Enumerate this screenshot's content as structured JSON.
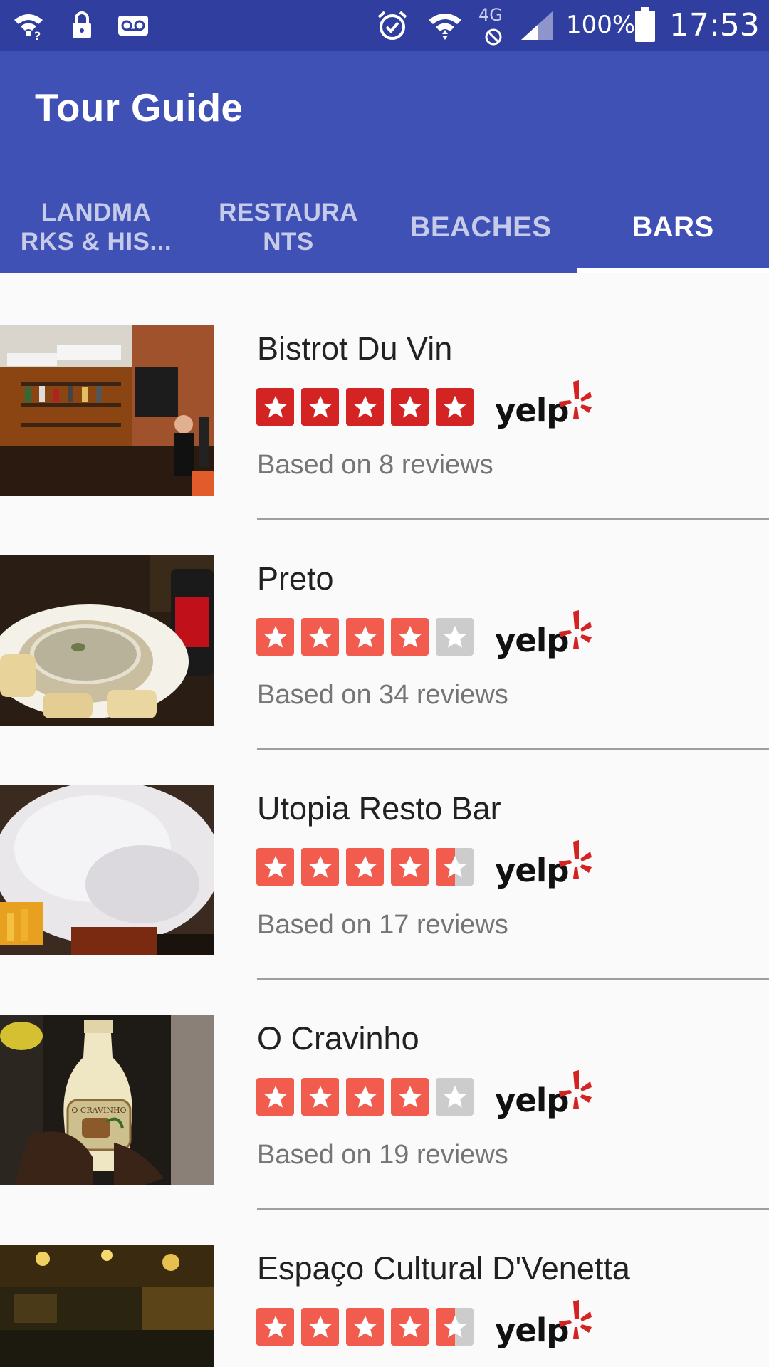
{
  "status_bar": {
    "battery": "100%",
    "time": "17:53",
    "network": "4G",
    "icons": [
      "wifi-question-icon",
      "lock-icon",
      "voicemail-icon",
      "alarm-icon",
      "wifi-icon",
      "no-data-icon",
      "signal-icon",
      "battery-icon"
    ]
  },
  "app_bar": {
    "title": "Tour Guide",
    "background": "#3f51b5",
    "status_background": "#303f9f"
  },
  "tabs": [
    {
      "label": "LANDMA\nRKS & HIS...",
      "active": false
    },
    {
      "label": "RESTAURA\nNTS",
      "active": false
    },
    {
      "label": "BEACHES",
      "active": false
    },
    {
      "label": "BARS",
      "active": true
    }
  ],
  "list": {
    "items": [
      {
        "name": "Bistrot Du Vin",
        "rating": 5,
        "reviews": "Based on 8 reviews",
        "image": "bar-interior-photo"
      },
      {
        "name": "Preto",
        "rating": 4,
        "reviews": "Based on 34 reviews",
        "image": "soup-dish-photo"
      },
      {
        "name": "Utopia Resto Bar",
        "rating": 4.5,
        "reviews": "Based on 17 reviews",
        "image": "cotton-candy-photo"
      },
      {
        "name": "O Cravinho",
        "rating": 4,
        "reviews": "Based on 19 reviews",
        "image": "bottle-in-hand-photo"
      },
      {
        "name": "Espaço Cultural D'Venetta",
        "rating": 4.5,
        "reviews": "",
        "image": "night-venue-photo"
      }
    ]
  },
  "yelp": {
    "wordmark": "yelp"
  },
  "colors": {
    "star_full_5": "#d32323",
    "star_full_4": "#f15c4f",
    "star_empty": "#cccccc",
    "yelp_red": "#d32323"
  }
}
